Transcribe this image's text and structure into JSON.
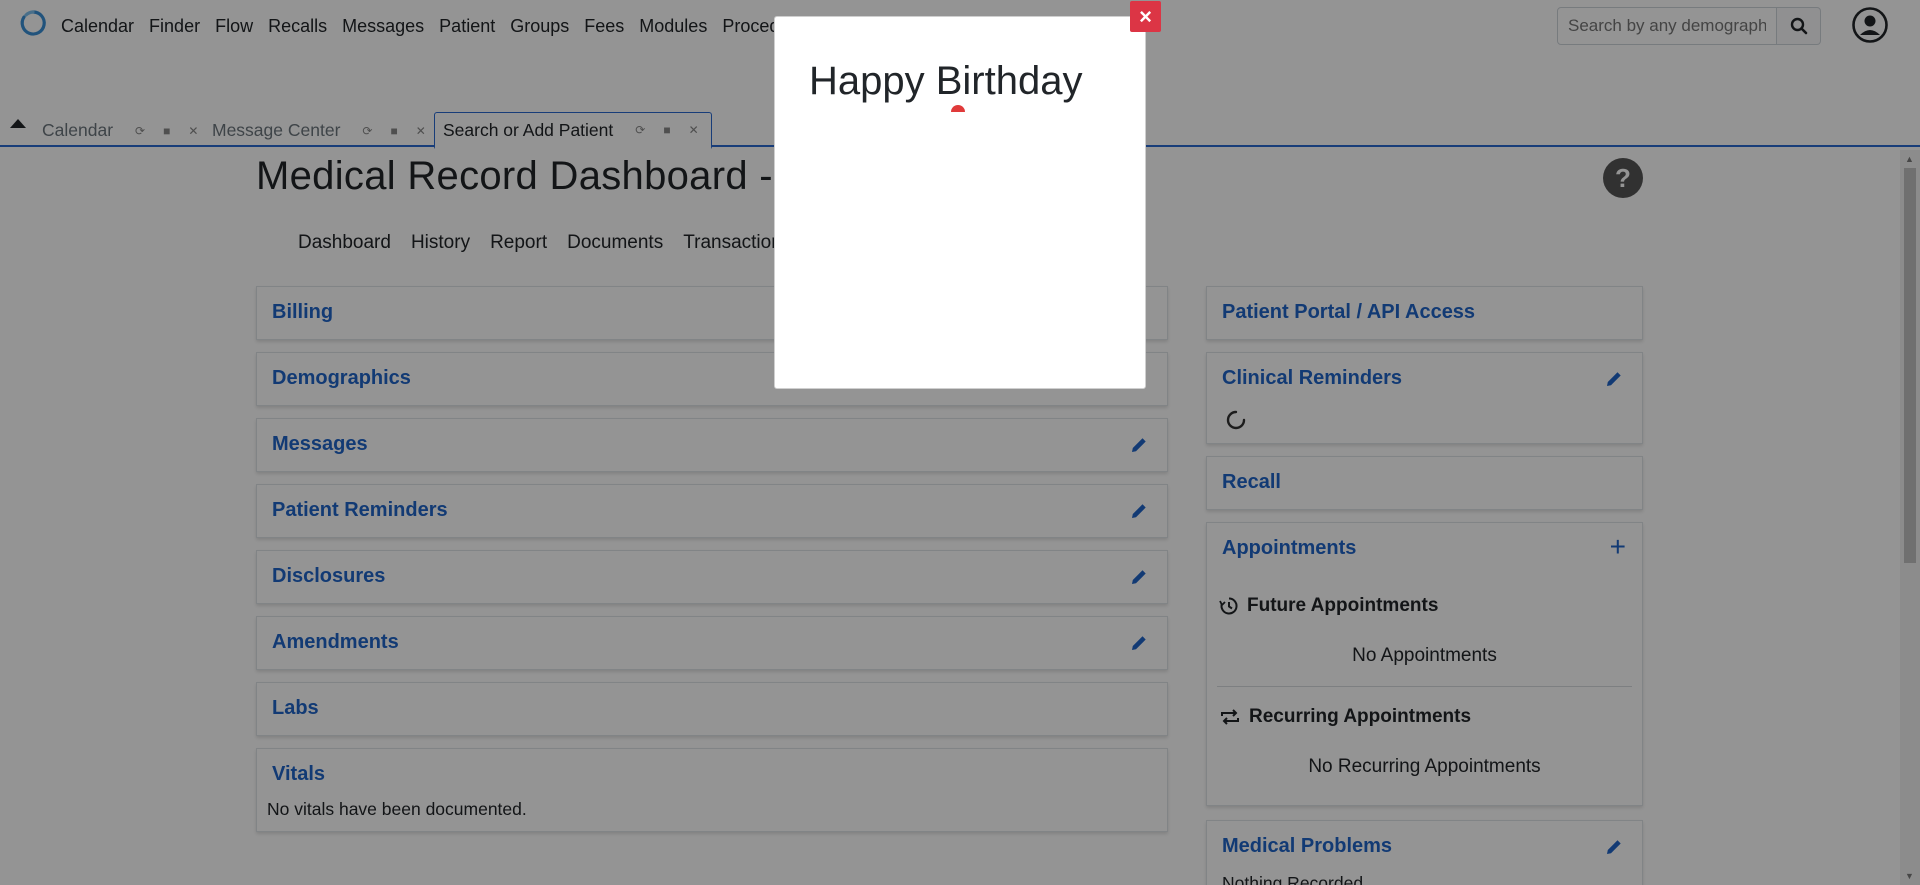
{
  "navbar": {
    "logo": "openemr-logo",
    "menu": [
      "Calendar",
      "Finder",
      "Flow",
      "Recalls",
      "Messages",
      "Patient",
      "Groups",
      "Fees",
      "Modules",
      "Procedures"
    ],
    "search_placeholder": "Search by any demographics",
    "search_icon": "search-icon",
    "user_icon": "user-circle-icon"
  },
  "tabs": [
    {
      "label": "Calendar",
      "active": false
    },
    {
      "label": "Message Center",
      "active": false
    },
    {
      "label": "Search or Add Patient",
      "active": true
    }
  ],
  "page": {
    "title": "Medical Record Dashboard -",
    "help_label": "?",
    "subnav": [
      "Dashboard",
      "History",
      "Report",
      "Documents",
      "Transactions"
    ]
  },
  "left_cards": [
    {
      "title": "Billing",
      "editable": false
    },
    {
      "title": "Demographics",
      "editable": true
    },
    {
      "title": "Messages",
      "editable": true
    },
    {
      "title": "Patient Reminders",
      "editable": true
    },
    {
      "title": "Disclosures",
      "editable": true
    },
    {
      "title": "Amendments",
      "editable": true
    },
    {
      "title": "Labs",
      "editable": false
    },
    {
      "title": "Vitals",
      "editable": false,
      "body": "No vitals have been documented."
    }
  ],
  "right_cards": {
    "portal": {
      "title": "Patient Portal / API Access"
    },
    "clinical": {
      "title": "Clinical Reminders"
    },
    "recall": {
      "title": "Recall"
    },
    "appointments": {
      "title": "Appointments",
      "add_label": "+",
      "future_title": "Future Appointments",
      "future_empty": "No Appointments",
      "recurring_title": "Recurring Appointments",
      "recurring_empty": "No Recurring Appointments"
    },
    "problems": {
      "title": "Medical Problems",
      "body": "Nothing Recorded"
    }
  },
  "modal": {
    "title": "Happy Birthday",
    "close_label": "×"
  },
  "colors": {
    "link": "#1f65c9",
    "tab_accent": "#2a6ad1",
    "close": "#dc3545"
  }
}
